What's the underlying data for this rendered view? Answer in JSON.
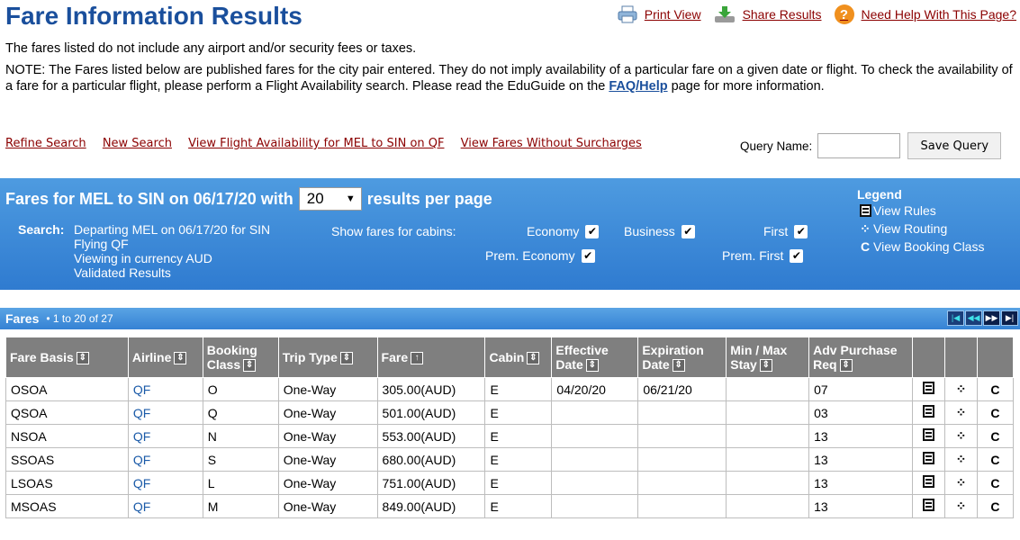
{
  "page": {
    "title": "Fare Information Results",
    "top_links": {
      "print": "Print View",
      "share": "Share Results",
      "help": "Need Help With This Page?",
      "print_icon": "printer-icon",
      "share_icon": "download-share-icon",
      "help_icon": "question-circle-icon",
      "help_glyph": "?"
    },
    "disclaimer": "The fares listed do not include any airport and/or security fees or taxes.",
    "note_text": "NOTE: The Fares listed below are published fares for the city pair entered. They do not imply availability of a particular fare on a given date or flight. To check the availability of a fare for a particular flight, please perform a Flight Availability search. Please read the EduGuide on the ",
    "note_link": "FAQ/Help",
    "note_tail": " page for more information."
  },
  "actions": {
    "refine": "Refine Search",
    "new": "New Search",
    "availability": "View Flight Availability for MEL to SIN on QF",
    "no_surcharges": "View Fares Without Surcharges"
  },
  "query": {
    "label": "Query Name:",
    "value": "",
    "save": "Save Query"
  },
  "summary": {
    "title_pre": "Fares for MEL to SIN on 06/17/20 with",
    "per_page": "20",
    "title_post": "results per page",
    "search_label": "Search:",
    "search_lines": [
      "Departing MEL on 06/17/20 for SIN",
      "Flying QF",
      "Viewing in currency AUD",
      "Validated Results"
    ],
    "cabins_label": "Show fares for cabins:",
    "cabins": {
      "economy": "Economy",
      "business": "Business",
      "first": "First",
      "prem_economy": "Prem. Economy",
      "prem_first": "Prem. First"
    },
    "check": "✔",
    "legend": {
      "title": "Legend",
      "rules": "View Rules",
      "routing": "View Routing",
      "booking": "View Booking Class"
    }
  },
  "fares_bar": {
    "title": "Fares",
    "count": "• 1 to 20 of 27",
    "pager": [
      "|◀",
      "◀◀",
      "▶▶",
      "▶|"
    ]
  },
  "table": {
    "headers": {
      "basis": "Fare Basis",
      "airline": "Airline",
      "booking1": "Booking",
      "booking2": "Class",
      "trip": "Trip Type",
      "fare": "Fare",
      "cabin": "Cabin",
      "eff1": "Effective",
      "eff2": "Date",
      "exp1": "Expiration",
      "exp2": "Date",
      "stay1": "Min / Max",
      "stay2": "Stay",
      "adv1": "Adv Purchase",
      "adv2": "Req"
    },
    "rows": [
      {
        "basis": "OSOA",
        "airline": "QF",
        "class": "O",
        "trip": "One-Way",
        "fare": "305.00(AUD)",
        "cabin": "E",
        "eff": "04/20/20",
        "exp": "06/21/20",
        "stay": "",
        "adv": "07"
      },
      {
        "basis": "QSOA",
        "airline": "QF",
        "class": "Q",
        "trip": "One-Way",
        "fare": "501.00(AUD)",
        "cabin": "E",
        "eff": "",
        "exp": "",
        "stay": "",
        "adv": "03"
      },
      {
        "basis": "NSOA",
        "airline": "QF",
        "class": "N",
        "trip": "One-Way",
        "fare": "553.00(AUD)",
        "cabin": "E",
        "eff": "",
        "exp": "",
        "stay": "",
        "adv": "13"
      },
      {
        "basis": "SSOAS",
        "airline": "QF",
        "class": "S",
        "trip": "One-Way",
        "fare": "680.00(AUD)",
        "cabin": "E",
        "eff": "",
        "exp": "",
        "stay": "",
        "adv": "13"
      },
      {
        "basis": "LSOAS",
        "airline": "QF",
        "class": "L",
        "trip": "One-Way",
        "fare": "751.00(AUD)",
        "cabin": "E",
        "eff": "",
        "exp": "",
        "stay": "",
        "adv": "13"
      },
      {
        "basis": "MSOAS",
        "airline": "QF",
        "class": "M",
        "trip": "One-Way",
        "fare": "849.00(AUD)",
        "cabin": "E",
        "eff": "",
        "exp": "",
        "stay": "",
        "adv": "13"
      }
    ]
  },
  "glyphs": {
    "sort": "⇕",
    "sort_active": "↑",
    "routing": "⁘",
    "booking": "C",
    "dropdown": "▼"
  },
  "colors": {
    "title": "#1a4f9c",
    "link": "#8b0000",
    "panel": "#3a87d8",
    "header": "#7f7f7f"
  }
}
